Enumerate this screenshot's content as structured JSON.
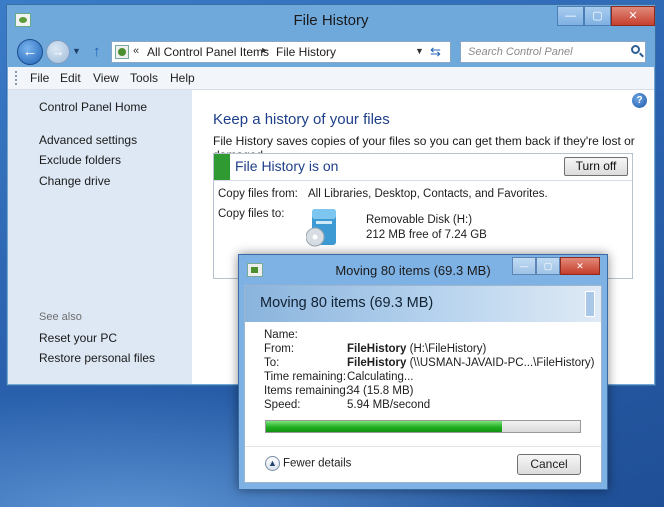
{
  "window": {
    "title": "File History",
    "controls": {
      "minimize": "—",
      "maximize": "▢",
      "close": "✕"
    }
  },
  "address": {
    "chevron": "«",
    "crumbs": [
      "All Control Panel Items",
      "File History"
    ],
    "separator": "▸"
  },
  "search": {
    "placeholder": "Search Control Panel"
  },
  "menu": [
    "File",
    "Edit",
    "View",
    "Tools",
    "Help"
  ],
  "sidebar": {
    "links": [
      "Control Panel Home",
      "Advanced settings",
      "Exclude folders",
      "Change drive"
    ],
    "see_also_label": "See also",
    "see_also": [
      "Reset your PC",
      "Restore personal files"
    ]
  },
  "main": {
    "heading": "Keep a history of your files",
    "description": "File History saves copies of your files so you can get them back if they're lost or damaged.",
    "status": {
      "title": "File History is on",
      "status_color": "#2f9a32",
      "turn_off_label": "Turn off",
      "copy_from_label": "Copy files from:",
      "copy_from_value": "All Libraries, Desktop, Contacts, and Favorites.",
      "copy_to_label": "Copy files to:",
      "drive_name": "Removable Disk (H:)",
      "drive_free": "212 MB free of 7.24 GB",
      "drive_icon": "removable-disk-icon"
    }
  },
  "dialog": {
    "title": "Moving 80 items (69.3 MB)",
    "heading": "Moving 80 items (69.3 MB)",
    "rows": {
      "name_label": "Name:",
      "from_label": "From:",
      "from_bold": "FileHistory",
      "from_path": "(H:\\FileHistory)",
      "to_label": "To:",
      "to_bold": "FileHistory",
      "to_path": "(\\\\USMAN-JAVAID-PC...\\FileHistory)",
      "time_label": "Time remaining:",
      "time_value": "Calculating...",
      "items_label": "Items remaining:",
      "items_value": "34 (15.8 MB)",
      "speed_label": "Speed:",
      "speed_value": "5.94 MB/second"
    },
    "progress_fraction": 0.75,
    "progress_color": "#22b022",
    "fewer_details_label": "Fewer details",
    "cancel_label": "Cancel"
  }
}
